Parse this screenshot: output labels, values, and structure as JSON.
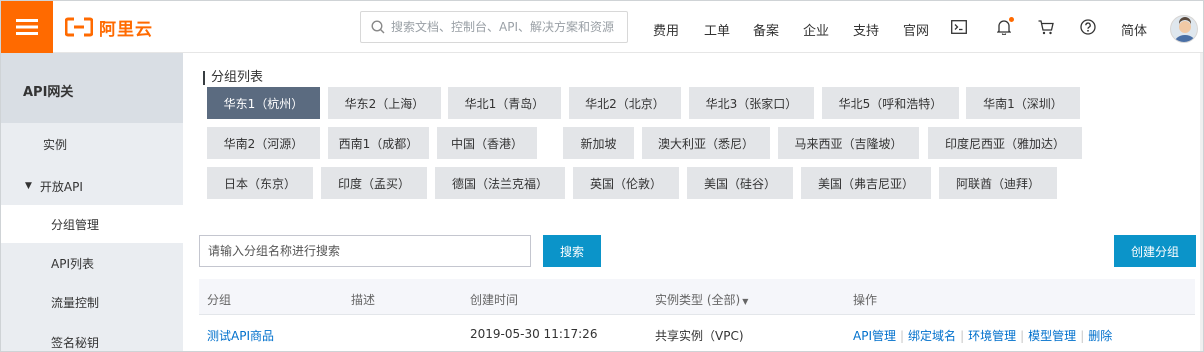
{
  "header": {
    "logo_text": "阿里云",
    "search_placeholder": "搜索文档、控制台、API、解决方案和资源",
    "nav": [
      "费用",
      "工单",
      "备案",
      "企业",
      "支持",
      "官网"
    ],
    "icons": [
      "terminal-icon",
      "bell-icon",
      "cart-icon",
      "help-icon"
    ],
    "lang": "简体",
    "accent": "#ff6a00"
  },
  "sidebar": {
    "title": "API网关",
    "items": [
      {
        "label": "实例"
      },
      {
        "label": "开放API"
      },
      {
        "label": "分组管理"
      },
      {
        "label": "API列表"
      },
      {
        "label": "流量控制"
      },
      {
        "label": "签名秘钥"
      }
    ]
  },
  "main": {
    "section_title": "分组列表",
    "regions": [
      "华东1（杭州）",
      "华东2（上海）",
      "华北1（青岛）",
      "华北2（北京）",
      "华北3（张家口）",
      "华北5（呼和浩特）",
      "华南1（深圳）",
      "华南2（河源）",
      "西南1（成都）",
      "中国（香港）",
      "新加坡",
      "澳大利亚（悉尼）",
      "马来西亚（吉隆坡）",
      "印度尼西亚（雅加达）",
      "日本（东京）",
      "印度（孟买）",
      "德国（法兰克福）",
      "英国（伦敦）",
      "美国（硅谷）",
      "美国（弗吉尼亚）",
      "阿联酋（迪拜）"
    ],
    "search_placeholder": "请输入分组名称进行搜索",
    "search_button": "搜索",
    "create_button": "创建分组",
    "columns": [
      "分组",
      "描述",
      "创建时间",
      "实例类型 (全部)",
      "操作"
    ],
    "rows": [
      {
        "name": "测试API商品",
        "description": "",
        "created": "2019-05-30 11:17:26",
        "instance_type": "共享实例（VPC)",
        "actions": [
          "API管理",
          "绑定域名",
          "环境管理",
          "模型管理",
          "删除"
        ]
      }
    ]
  }
}
